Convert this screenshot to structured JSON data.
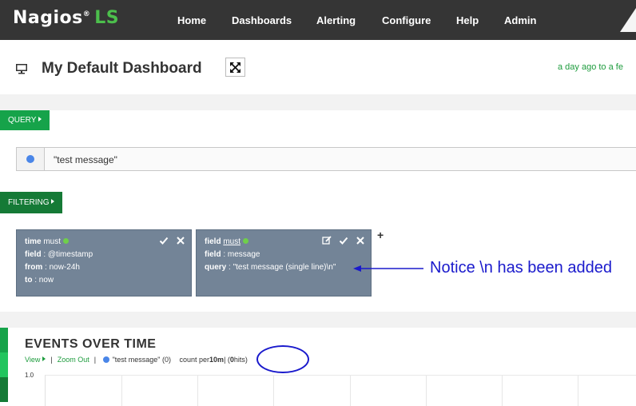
{
  "header": {
    "logo_main": "Nagios",
    "logo_reg": "®",
    "logo_suffix": "LS",
    "nav": [
      "Home",
      "Dashboards",
      "Alerting",
      "Configure",
      "Help",
      "Admin"
    ]
  },
  "dashboard": {
    "title": "My Default Dashboard",
    "timerange": "a day ago to a fe"
  },
  "query": {
    "tab_label": "QUERY",
    "value": "\"test message\"",
    "color": "#4a86e8"
  },
  "filtering": {
    "tab_label": "FILTERING",
    "filters": [
      {
        "type_key": "time",
        "mandate": "must",
        "field_key": "field",
        "field_value": "@timestamp",
        "from_key": "from",
        "from_value": "now-24h",
        "to_key": "to",
        "to_value": "now"
      },
      {
        "type_key": "field",
        "mandate": "must",
        "field_key": "field",
        "field_value": "message",
        "query_key": "query",
        "query_value": "\"test message (single line)\\n\""
      }
    ],
    "add_symbol": "+",
    "annotation": "Notice \\n has been added"
  },
  "events": {
    "title": "EVENTS OVER TIME",
    "view_label": "View",
    "zoom_out_label": "Zoom Out",
    "series_label": "\"test message\" (0)",
    "count_per_text": "count per ",
    "interval": "10m",
    "hits_open": " | (",
    "hits_count": "0",
    "hits_close": " hits)",
    "y_tick": "1.0"
  },
  "colors": {
    "header_bg": "#353535",
    "accent_green": "#16a34a",
    "filter_green": "#157a36",
    "filter_card": "#738497",
    "annotation_blue": "#1a1acc"
  }
}
